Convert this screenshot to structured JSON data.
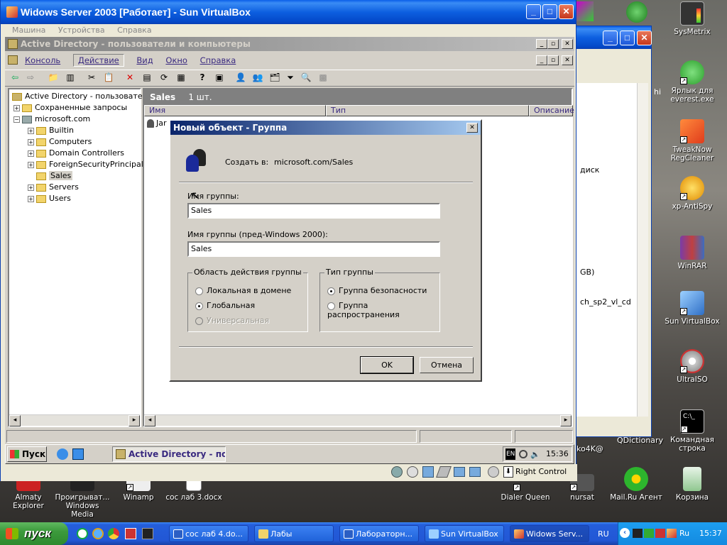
{
  "vm_window": {
    "title": "Widows Server 2003 [Работает] - Sun VirtualBox",
    "menu": [
      "Машина",
      "Устройства",
      "Справка"
    ]
  },
  "ad_window": {
    "title": "Active Directory - пользователи и компьютеры",
    "menu": [
      "Консоль",
      "Действие",
      "Вид",
      "Окно",
      "Справка"
    ],
    "tree": [
      {
        "label": "Active Directory - пользователи и"
      },
      {
        "label": "Сохраненные запросы"
      },
      {
        "label": "microsoft.com"
      },
      {
        "label": "Builtin"
      },
      {
        "label": "Computers"
      },
      {
        "label": "Domain Controllers"
      },
      {
        "label": "ForeignSecurityPrincipals"
      },
      {
        "label": "Sales"
      },
      {
        "label": "Servers"
      },
      {
        "label": "Users"
      }
    ],
    "panel_title": "Sales",
    "panel_count": "1 шт.",
    "columns": [
      "Имя",
      "Тип",
      "Описание"
    ],
    "row_partial": "Jar"
  },
  "dialog": {
    "title": "Новый объект - Группа",
    "create_in_label": "Создать в:",
    "create_in_value": "microsoft.com/Sales",
    "group_name_label": "Имя группы:",
    "group_name_value": "Sales",
    "group_name_pre2000_label": "Имя группы (пред-Windows 2000):",
    "group_name_pre2000_value": "Sales",
    "scope": {
      "legend": "Область действия группы",
      "options": [
        "Локальная в домене",
        "Глобальная",
        "Универсальная"
      ],
      "selected": "Глобальная"
    },
    "type": {
      "legend": "Тип группы",
      "options": [
        "Группа безопасности",
        "Группа распространения"
      ],
      "selected": "Группа безопасности"
    },
    "ok": "OK",
    "cancel": "Отмена"
  },
  "guest_taskbar": {
    "start": "Пуск",
    "task": "Active Directory - по...",
    "lang": "EN",
    "time": "15:36"
  },
  "vbox_status": {
    "host_key": "Right Control"
  },
  "background_window": {
    "fragments": [
      "диск",
      "GB)",
      "ch_sp2_vl_cd",
      "hi",
      "ko4K@",
      "QDictionary"
    ]
  },
  "desktop_icons": [
    {
      "label": "SysMetrix"
    },
    {
      "label": "Ярлык для everest.exe"
    },
    {
      "label": "TweakNow RegCleaner"
    },
    {
      "label": "xp-AntiSpy"
    },
    {
      "label": "WinRAR"
    },
    {
      "label": "Sun VirtualBox"
    },
    {
      "label": "UltraISO"
    },
    {
      "label": "Командная строка"
    },
    {
      "label": "Almaty Explorer"
    },
    {
      "label": "Проигрыват... Windows Media"
    },
    {
      "label": "Winamp"
    },
    {
      "label": "сос лаб 3.docx"
    },
    {
      "label": "Dialer Queen"
    },
    {
      "label": "nursat"
    },
    {
      "label": "Mail.Ru Агент"
    },
    {
      "label": "Корзина"
    }
  ],
  "host_taskbar": {
    "start": "пуск",
    "tasks": [
      "сос лаб 4.do...",
      "Лабы",
      "Лабораторн...",
      "Sun VirtualBox",
      "Widows Serv..."
    ],
    "lang": "RU",
    "tray_lang": "Ru",
    "time": "15:37"
  },
  "colors": {
    "xp_blue": "#0d5fe0",
    "classic_title": "#0a246a",
    "classic_face": "#d4d0c8",
    "taskbar_green": "#3c9a3c"
  }
}
